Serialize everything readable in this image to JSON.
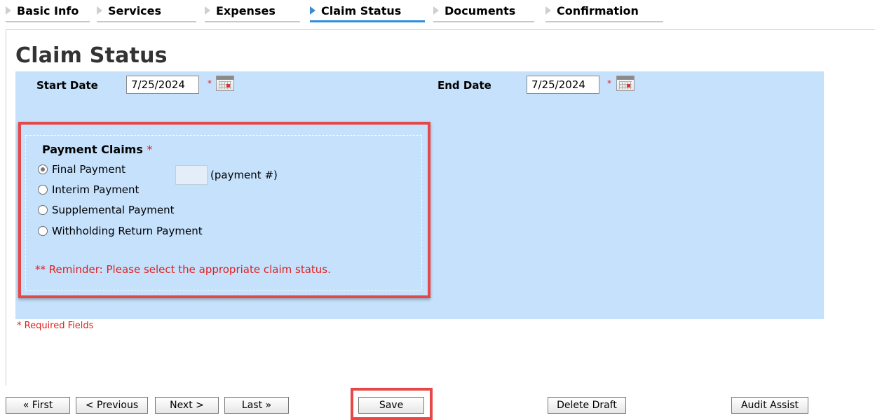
{
  "tabs": [
    {
      "label": "Basic Info"
    },
    {
      "label": "Services"
    },
    {
      "label": "Expenses"
    },
    {
      "label": "Claim Status"
    },
    {
      "label": "Documents"
    },
    {
      "label": "Confirmation"
    }
  ],
  "active_tab": "Claim Status",
  "page_title": "Claim Status",
  "dates": {
    "start_label": "Start Date",
    "start_value": "7/25/2024",
    "end_label": "End Date",
    "end_value": "7/25/2024",
    "required_mark": "*"
  },
  "payment": {
    "title": "Payment Claims",
    "required_mark": "*",
    "options": [
      {
        "label": "Final Payment",
        "checked": true
      },
      {
        "label": "Interim Payment",
        "checked": false
      },
      {
        "label": "Supplemental Payment",
        "checked": false
      },
      {
        "label": "Withholding Return Payment",
        "checked": false
      }
    ],
    "payment_number_label": "(payment #)",
    "payment_number_value": "",
    "reminder": "** Reminder: Please select the appropriate claim status."
  },
  "required_note": "* Required Fields",
  "buttons": {
    "first": "« First",
    "previous": "< Previous",
    "next": "Next >",
    "last": "Last »",
    "save": "Save",
    "delete_draft": "Delete Draft",
    "audit_assist": "Audit Assist"
  },
  "colors": {
    "accent": "#2b8fe0",
    "panel_bg": "#c5e1fb",
    "highlight": "#e64848",
    "required": "#e02020"
  }
}
